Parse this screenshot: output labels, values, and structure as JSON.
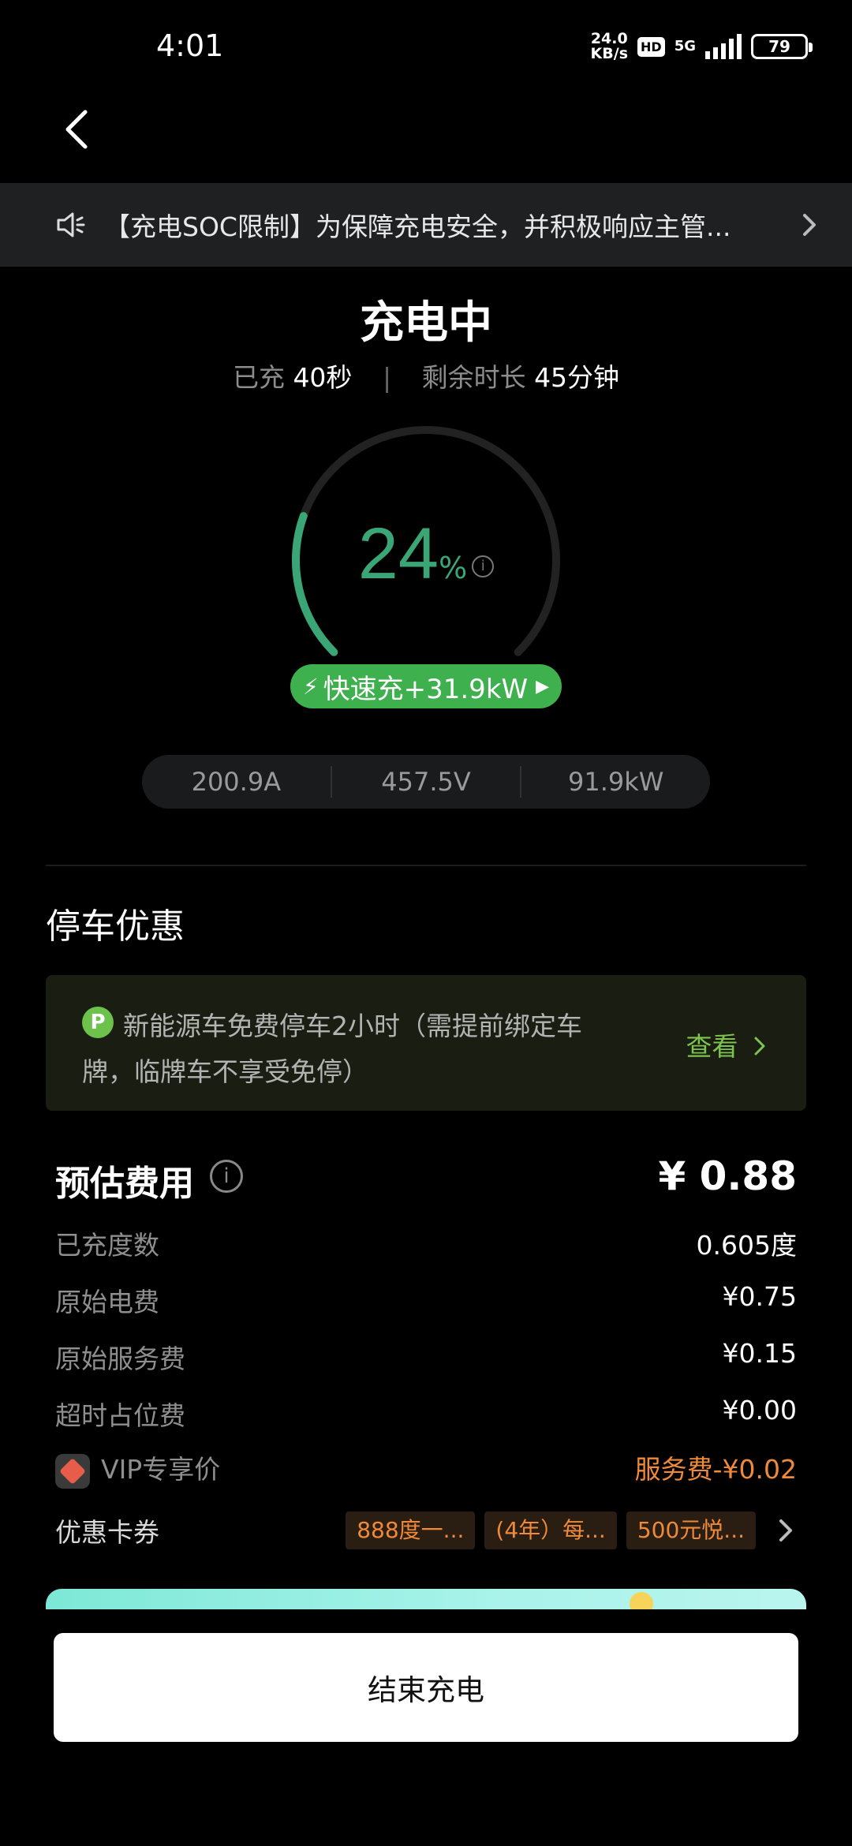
{
  "status_bar": {
    "time": "4:01",
    "net_speed_value": "24.0",
    "net_speed_unit": "KB/s",
    "hd": "HD",
    "network": "5G",
    "battery": "79"
  },
  "notice": {
    "icon": "speaker-icon",
    "text": "【充电SOC限制】为保障充电安全，并积极响应主管..."
  },
  "charging": {
    "title": "充电中",
    "elapsed_label": "已充",
    "elapsed_value": "40秒",
    "remaining_label": "剩余时长",
    "remaining_value": "45分钟",
    "percent": "24",
    "percent_unit": "%",
    "soc_fraction": 0.24,
    "gauge_color": "#3aa676",
    "fast_label": "快速充+31.9kW",
    "current": "200.9A",
    "voltage": "457.5V",
    "power": "91.9kW"
  },
  "parking": {
    "title": "停车优惠",
    "icon_letter": "P",
    "text": "新能源车免费停车2小时（需提前绑定车牌，临牌车不享受免停）",
    "link": "查看"
  },
  "cost": {
    "title": "预估费用",
    "total": "¥ 0.88",
    "rows": [
      {
        "label": "已充度数",
        "value": "0.605度"
      },
      {
        "label": "原始电费",
        "value": "¥0.75"
      },
      {
        "label": "原始服务费",
        "value": "¥0.15"
      },
      {
        "label": "超时占位费",
        "value": "¥0.00"
      }
    ],
    "vip_label": "VIP专享价",
    "vip_value": "服务费-¥0.02",
    "coupon_label": "优惠卡券",
    "coupons": [
      "888度一...",
      "(4年）每...",
      "500元悦..."
    ],
    "accent_color": "#ef8a3a"
  },
  "end_button": "结束充电"
}
